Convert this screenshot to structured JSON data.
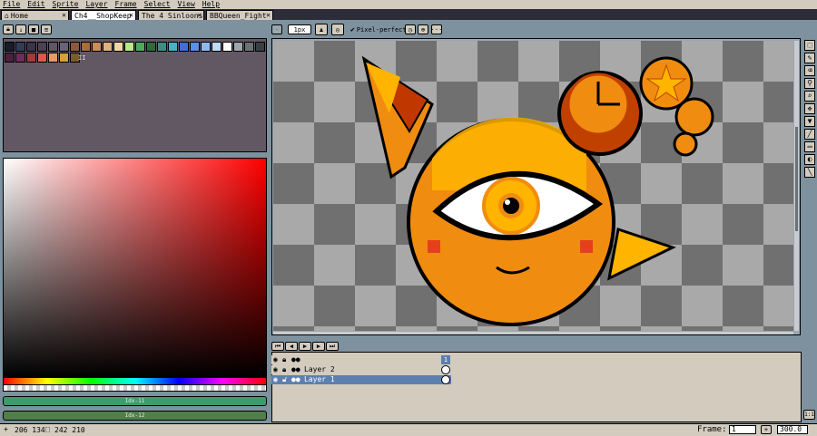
{
  "menu": [
    "File",
    "Edit",
    "Sprite",
    "Layer",
    "Frame",
    "Select",
    "View",
    "Help"
  ],
  "tabs": [
    {
      "label": "Home"
    },
    {
      "label": "Ch4__ShopKeep"
    },
    {
      "label": "The 4 Sinloons"
    },
    {
      "label": "BBQueen_Fight"
    }
  ],
  "toolbar": {
    "brush_size": "1px",
    "pixel_perfect_label": "Pixel-perfect",
    "pixel_perfect_checked": true
  },
  "palette": {
    "row1": [
      "#1a1c2c",
      "#333c57",
      "#3a3548",
      "#4a4355",
      "#5d5768",
      "#6b6377",
      "#8b5a3c",
      "#a86d3b",
      "#c98c5a",
      "#e0b07c",
      "#f0d6a3",
      "#b8e986",
      "#4fa95b",
      "#2e6b3b",
      "#3b8f82",
      "#4ab0c7",
      "#3f6fd4",
      "#5b8fe8",
      "#8fb8f0",
      "#c0dcf5",
      "#ffffff",
      "#9ea6aa",
      "#6c7378",
      "#3a3f44"
    ],
    "row2": [
      "#4d2040",
      "#6b2e5a",
      "#a03c3c",
      "#d85a4a",
      "#e89a6a",
      "#d4a03a",
      "#7a5c2a"
    ],
    "label": "II"
  },
  "color_bars": {
    "fg": "Idx-11",
    "bg": "Idx-12"
  },
  "layers": [
    {
      "name": "",
      "frame": "1"
    },
    {
      "name": "Layer 2"
    },
    {
      "name": "Layer 1"
    }
  ],
  "status": {
    "cursor": "206 134",
    "selection_size": "242 210",
    "frame_label": "Frame:",
    "frame_value": "1",
    "zoom": "300.0"
  },
  "colors": {
    "accent_green": "#3c9c6c",
    "accent_dark_green": "#4f7f4a",
    "orange": "#f08c10",
    "yellow": "#ffb400",
    "red": "#c04000"
  }
}
